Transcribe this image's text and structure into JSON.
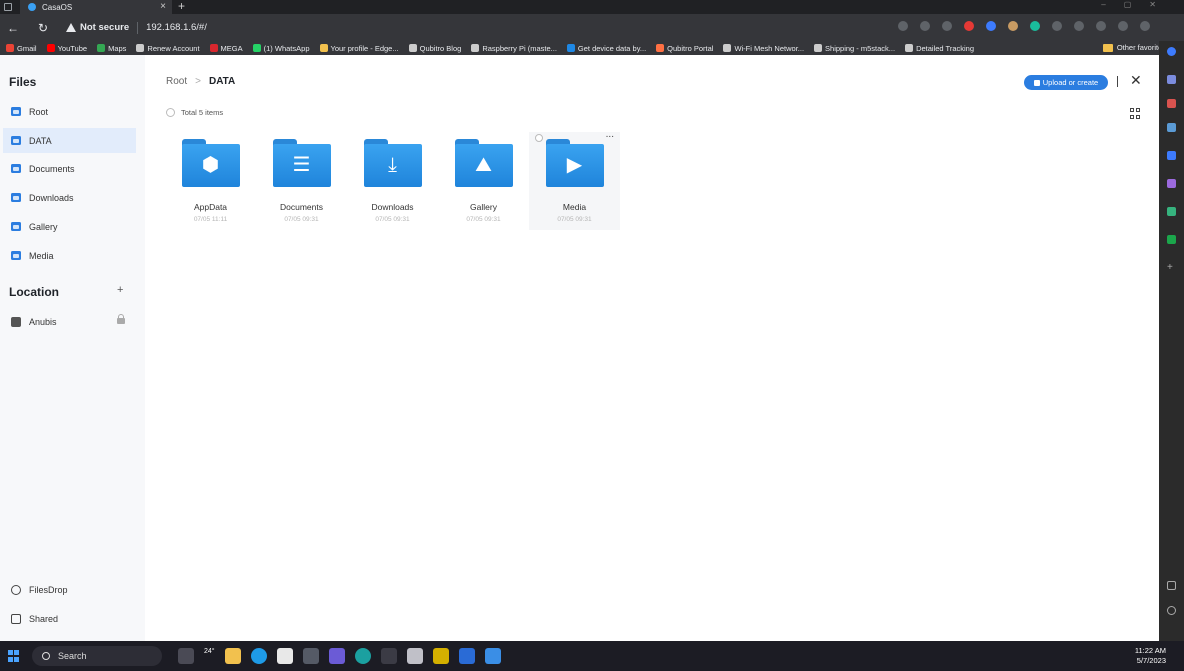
{
  "browser": {
    "tab_title": "CasaOS",
    "security_label": "Not secure",
    "url": "192.168.1.6/#/",
    "bookmarks": [
      {
        "label": "Gmail",
        "color": "#ea4335"
      },
      {
        "label": "YouTube",
        "color": "#ff0000"
      },
      {
        "label": "Maps",
        "color": "#34a853"
      },
      {
        "label": "Renew Account",
        "color": "#cccccc"
      },
      {
        "label": "MEGA",
        "color": "#d9272e"
      },
      {
        "label": "(1) WhatsApp",
        "color": "#25d366"
      },
      {
        "label": "Your profile - Edge...",
        "color": "#f2c14e"
      },
      {
        "label": "Qubitro Blog",
        "color": "#cccccc"
      },
      {
        "label": "Raspberry Pi (maste...",
        "color": "#cccccc"
      },
      {
        "label": "Get device data by...",
        "color": "#1e88e5"
      },
      {
        "label": "Qubitro Portal",
        "color": "#ff7043"
      },
      {
        "label": "Wi-Fi Mesh Networ...",
        "color": "#cccccc"
      },
      {
        "label": "Shipping - m5stack...",
        "color": "#cccccc"
      },
      {
        "label": "Detailed Tracking",
        "color": "#cccccc"
      }
    ],
    "other_favorites": "Other favorites"
  },
  "sidebar": {
    "files_heading": "Files",
    "items": [
      {
        "label": "Root"
      },
      {
        "label": "DATA"
      },
      {
        "label": "Documents"
      },
      {
        "label": "Downloads"
      },
      {
        "label": "Gallery"
      },
      {
        "label": "Media"
      }
    ],
    "location_heading": "Location",
    "location_items": [
      {
        "label": "Anubis"
      }
    ],
    "bottom_items": [
      {
        "label": "FilesDrop"
      },
      {
        "label": "Shared"
      }
    ]
  },
  "main": {
    "breadcrumb": {
      "root": "Root",
      "separator": ">",
      "current": "DATA"
    },
    "upload_label": "Upload or create",
    "total_items": "Total 5 items",
    "files": [
      {
        "name": "AppData",
        "date": "07/05 11:11",
        "icon": "cube-icon",
        "glyph": "⬢"
      },
      {
        "name": "Documents",
        "date": "07/05 09:31",
        "icon": "document-icon",
        "glyph": "☰"
      },
      {
        "name": "Downloads",
        "date": "07/05 09:31",
        "icon": "download-icon",
        "glyph": "⤓"
      },
      {
        "name": "Gallery",
        "date": "07/05 09:31",
        "icon": "image-icon",
        "glyph": "⛰"
      },
      {
        "name": "Media",
        "date": "07/05 09:31",
        "icon": "play-icon",
        "glyph": "▶"
      }
    ],
    "more_menu": "..."
  },
  "taskbar": {
    "search_label": "Search",
    "weather": "24°",
    "time": "11:22 AM",
    "date": "5/7/2023"
  },
  "colors": {
    "accent": "#2b7de0",
    "folder": "#1f84db",
    "active_bg": "#e2ecfb"
  }
}
